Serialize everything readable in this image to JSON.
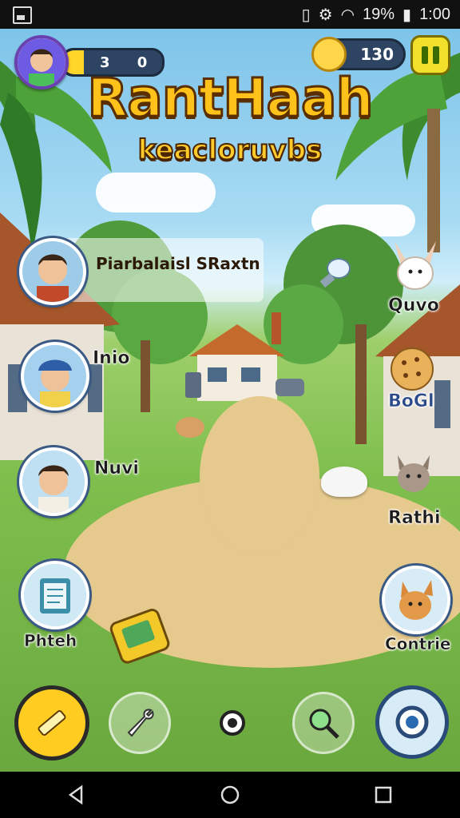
{
  "status_bar": {
    "signal": "■",
    "battery_pct": "19%",
    "time": "1:00"
  },
  "hud": {
    "score": "3 0",
    "coins": "130"
  },
  "title": {
    "main": "RantHaah",
    "sub": "keacloruvbs"
  },
  "banner": {
    "text": "Piarbalaisl SRaxtn"
  },
  "left_characters": [
    {
      "label": "Inio"
    },
    {
      "label": "Nuvi"
    },
    {
      "label": "Phteh"
    }
  ],
  "right_characters": [
    {
      "label": "Quvo"
    },
    {
      "label": "BoGl"
    },
    {
      "label": "Rathi"
    },
    {
      "label": "Contrie"
    }
  ],
  "colors": {
    "title": "#ffc21a",
    "outline": "#5b2e00",
    "hud": "#2d4563",
    "pause": "#f3e02c"
  },
  "icons": [
    "pencil-icon",
    "wrench-icon",
    "gear-icon",
    "magnifier-icon",
    "settings-icon",
    "back-icon",
    "home-icon",
    "recent-icon"
  ]
}
